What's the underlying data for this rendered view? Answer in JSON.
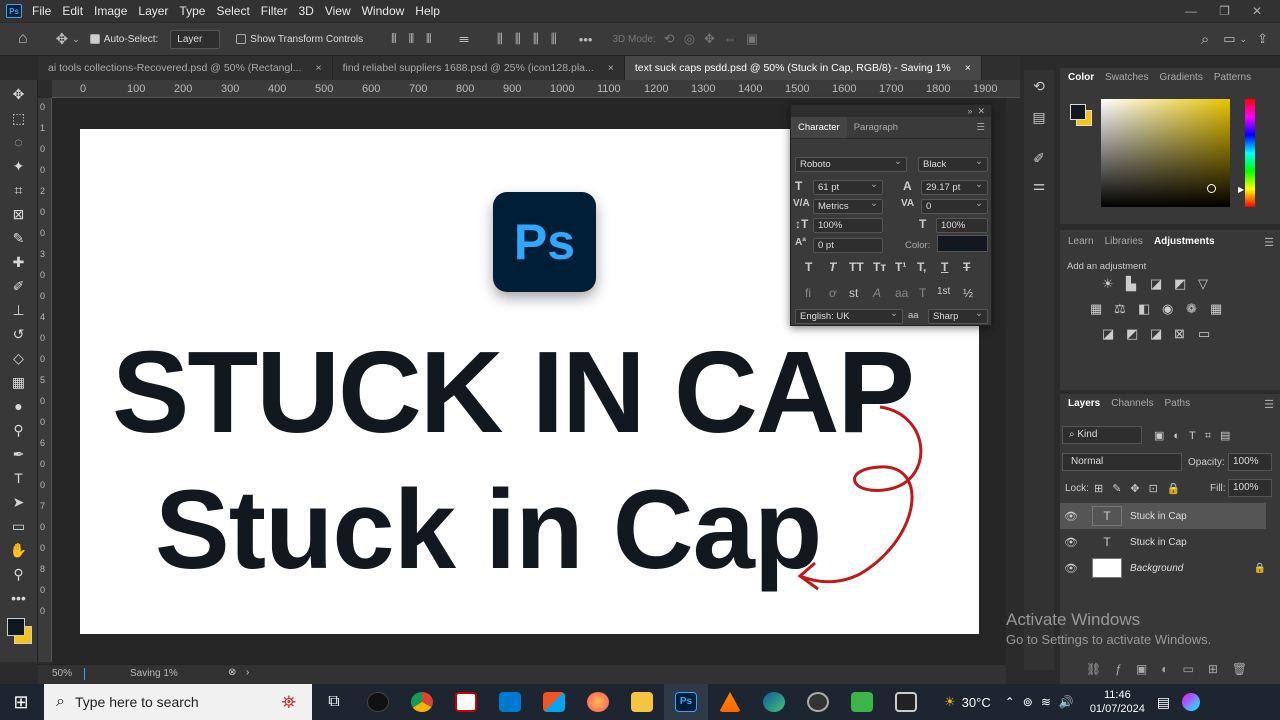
{
  "menubar": {
    "items": [
      "File",
      "Edit",
      "Image",
      "Layer",
      "Type",
      "Select",
      "Filter",
      "3D",
      "View",
      "Window",
      "Help"
    ],
    "app_icon": "Ps"
  },
  "options": {
    "auto_select_label": "Auto-Select:",
    "auto_select_value": "Layer",
    "show_transform_label": "Show Transform Controls",
    "mode_3d_label": "3D Mode:"
  },
  "tabs": [
    {
      "label": "ai tools collections-Recovered.psd @ 50% (Rectangl...",
      "close": "×"
    },
    {
      "label": "find reliabel suppliers 1688.psd @ 25% (icon128.pla...",
      "close": "×"
    },
    {
      "label": "text suck caps psdd.psd @ 50% (Stuck in Cap, RGB/8) - Saving 1%",
      "close": "×"
    }
  ],
  "ruler": {
    "top_labels": [
      "0",
      "100",
      "200",
      "300",
      "400",
      "500",
      "600",
      "700",
      "800",
      "900",
      "1000",
      "1100",
      "1200",
      "1300",
      "1400",
      "1500",
      "1600",
      "1700",
      "1800",
      "1900"
    ]
  },
  "canvas": {
    "logo_text": "Ps",
    "line1": "STUCK IN CAP",
    "line2": "Stuck in Cap"
  },
  "status": {
    "zoom": "50%",
    "saving": "Saving 1%"
  },
  "character_panel": {
    "tabs": [
      "Character",
      "Paragraph"
    ],
    "font_family": "Roboto",
    "font_style": "Black",
    "font_size": "61 pt",
    "leading": "29.17 pt",
    "kerning": "Metrics",
    "tracking": "0",
    "vertical_scale": "100%",
    "horizontal_scale": "100%",
    "baseline_shift": "0 pt",
    "color_label": "Color:",
    "language": "English: UK",
    "aa_label": "aa",
    "antialias": "Sharp",
    "style_buttons": [
      "T",
      "T",
      "TT",
      "Tт",
      "T¹",
      "T,",
      "T",
      "T"
    ],
    "opentype_buttons": [
      "fi",
      "ơ",
      "st",
      "A",
      "aa",
      "T",
      "1st",
      "½"
    ]
  },
  "color_panel": {
    "tabs": [
      "Color",
      "Swatches",
      "Gradients",
      "Patterns"
    ]
  },
  "adjustments_panel": {
    "tabs": [
      "Learn",
      "Libraries",
      "Adjustments"
    ],
    "add_label": "Add an adjustment"
  },
  "layers_panel": {
    "tabs": [
      "Layers",
      "Channels",
      "Paths"
    ],
    "filter_kind": "Kind",
    "blend_mode": "Normal",
    "opacity_label": "Opacity:",
    "opacity_value": "100%",
    "lock_label": "Lock:",
    "fill_label": "Fill:",
    "fill_value": "100%",
    "layers": [
      {
        "name": "Stuck in Cap",
        "type": "text",
        "selected": true
      },
      {
        "name": "Stuck in Cap",
        "type": "text",
        "selected": false
      },
      {
        "name": "Background",
        "type": "image",
        "selected": false
      }
    ]
  },
  "watermark": {
    "line1": "Activate Windows",
    "line2": "Go to Settings to activate Windows."
  },
  "taskbar": {
    "search_placeholder": "Type here to search",
    "weather": "30°C",
    "time": "11:46",
    "date": "01/07/2024"
  },
  "colors": {
    "foreground_swatch": "#111820",
    "background_swatch": "#f5c518",
    "ps_brand": "#31a8ff",
    "arrow": "#c01818"
  }
}
